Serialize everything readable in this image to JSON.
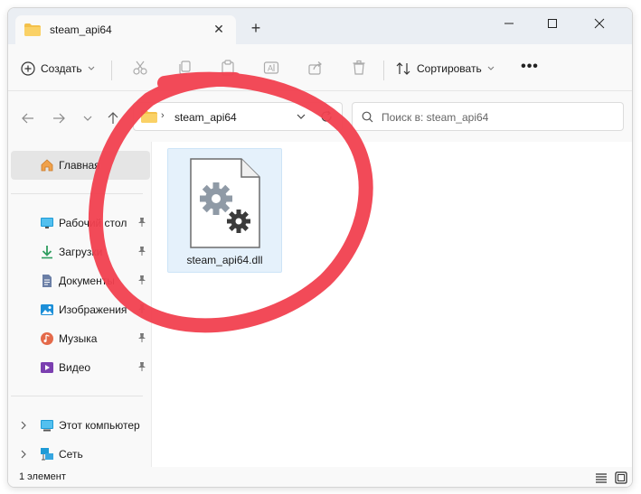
{
  "window": {
    "tab_title": "steam_api64",
    "new_tab": "+",
    "minimize": "minimize",
    "maximize": "maximize",
    "close": "close"
  },
  "commandbar": {
    "new_label": "Создать",
    "sort_label": "Сортировать",
    "more_label": "•••"
  },
  "address": {
    "path": "steam_api64",
    "search_placeholder": "Поиск в: steam_api64"
  },
  "sidebar": {
    "home": "Главная",
    "pinned": [
      {
        "label": "Рабочий стол",
        "icon": "desktop-icon"
      },
      {
        "label": "Загрузки",
        "icon": "downloads-icon"
      },
      {
        "label": "Документы",
        "icon": "documents-icon"
      },
      {
        "label": "Изображения",
        "icon": "pictures-icon"
      },
      {
        "label": "Музыка",
        "icon": "music-icon"
      },
      {
        "label": "Видео",
        "icon": "video-icon"
      }
    ],
    "this_pc": "Этот компьютер",
    "network": "Сеть"
  },
  "files": [
    {
      "name": "steam_api64.dll",
      "icon": "dll-gear-file-icon"
    }
  ],
  "status": {
    "count": "1 элемент"
  },
  "colors": {
    "accent": "#0067c0",
    "selection": "#e5f1fb",
    "annotation": "#f1404f"
  }
}
